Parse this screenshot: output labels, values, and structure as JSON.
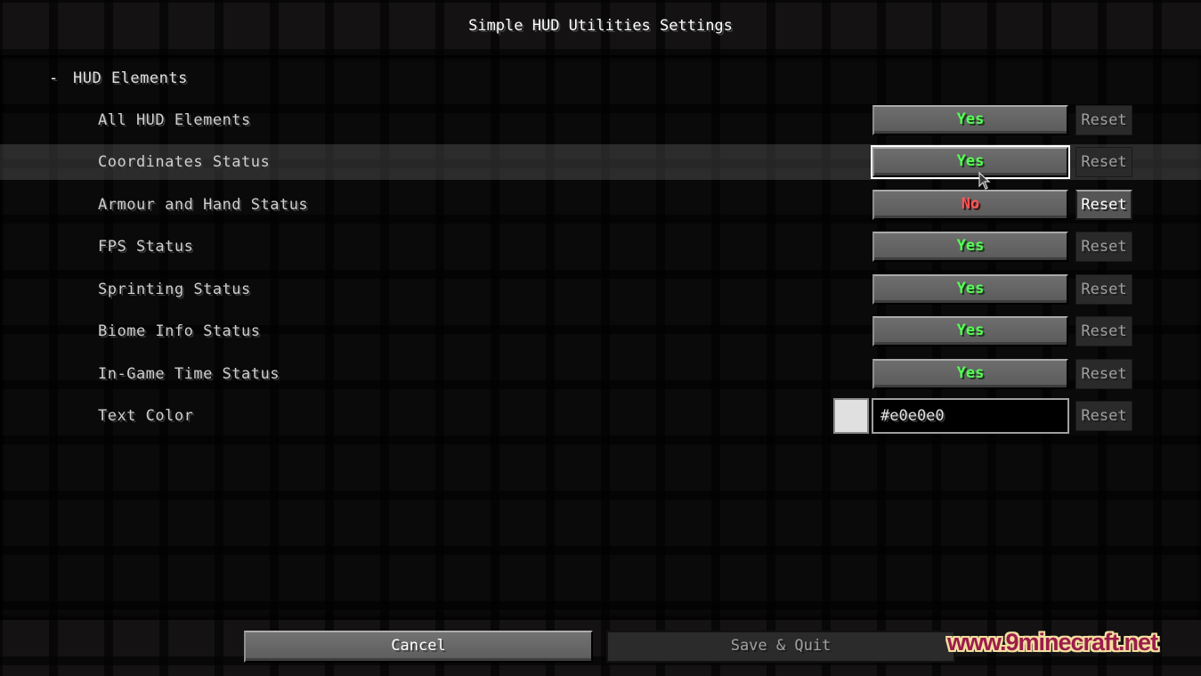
{
  "screen": {
    "title": "Simple HUD Utilities Settings"
  },
  "category": {
    "collapse_symbol": "-",
    "label": "HUD Elements"
  },
  "options": [
    {
      "label": "All HUD Elements",
      "value": "Yes",
      "value_color": "#55ff55",
      "reset_label": "Reset",
      "reset_enabled": false,
      "hovered": false
    },
    {
      "label": "Coordinates Status",
      "value": "Yes",
      "value_color": "#55ff55",
      "reset_label": "Reset",
      "reset_enabled": false,
      "hovered": true
    },
    {
      "label": "Armour and Hand Status",
      "value": "No",
      "value_color": "#ff5555",
      "reset_label": "Reset",
      "reset_enabled": true,
      "hovered": false
    },
    {
      "label": "FPS Status",
      "value": "Yes",
      "value_color": "#55ff55",
      "reset_label": "Reset",
      "reset_enabled": false,
      "hovered": false
    },
    {
      "label": "Sprinting Status",
      "value": "Yes",
      "value_color": "#55ff55",
      "reset_label": "Reset",
      "reset_enabled": false,
      "hovered": false
    },
    {
      "label": "Biome Info Status",
      "value": "Yes",
      "value_color": "#55ff55",
      "reset_label": "Reset",
      "reset_enabled": false,
      "hovered": false
    },
    {
      "label": "In-Game Time Status",
      "value": "Yes",
      "value_color": "#55ff55",
      "reset_label": "Reset",
      "reset_enabled": false,
      "hovered": false
    }
  ],
  "text_color": {
    "label": "Text Color",
    "value": "#e0e0e0",
    "swatch_color": "#e0e0e0",
    "reset_label": "Reset",
    "reset_enabled": false
  },
  "footer": {
    "cancel_label": "Cancel",
    "save_label": "Save & Quit",
    "save_enabled": false
  },
  "watermark": "www.9minecraft.net"
}
